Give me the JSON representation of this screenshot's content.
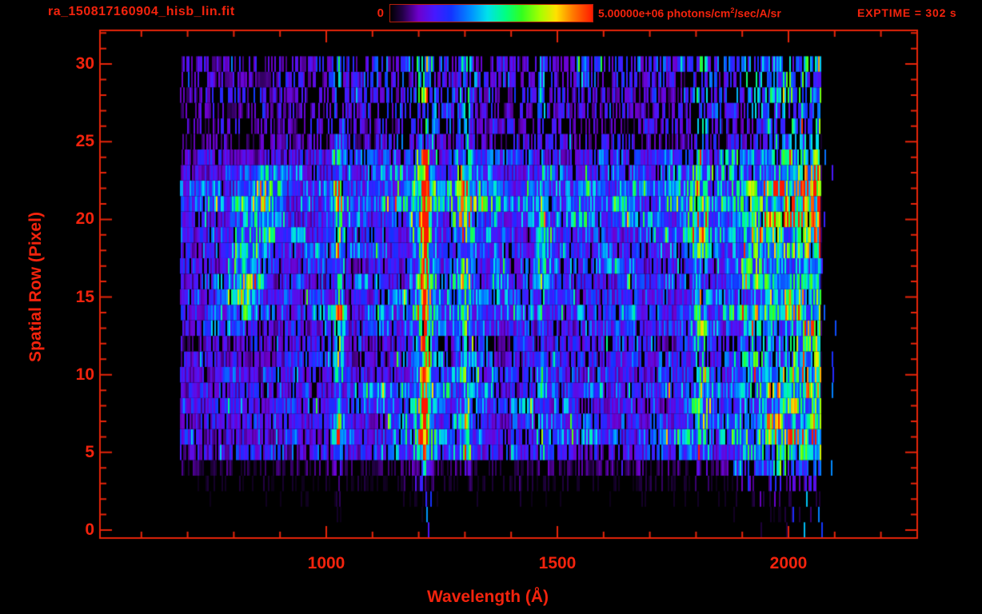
{
  "header": {
    "title": "ra_150817160904_hisb_lin.fit",
    "colorbar": {
      "min_label": "0",
      "max_value": "5.00000e+06",
      "units_prefix": "photons/cm",
      "units_sup": "2",
      "units_suffix": "/sec/A/sr"
    },
    "exptime": "EXPTIME = 302 s"
  },
  "axes": {
    "x": {
      "title": "Wavelength (Å)",
      "major_ticks": [
        1000,
        1500,
        2000
      ],
      "minor_step": 100,
      "range": [
        510,
        2278
      ]
    },
    "y": {
      "title": "Spatial Row (Pixel)",
      "major_ticks": [
        0,
        5,
        10,
        15,
        20,
        25,
        30
      ],
      "minor_step": 1,
      "range": [
        -0.5,
        32.2
      ]
    }
  },
  "chart_data": {
    "type": "heatmap",
    "title": "ra_150817160904_hisb_lin.fit",
    "xlabel": "Wavelength (Å)",
    "ylabel": "Spatial Row (Pixel)",
    "xlim": [
      510,
      2278
    ],
    "ylim": [
      -0.5,
      32.2
    ],
    "colorbar": {
      "min": 0,
      "max": 5000000,
      "units": "photons/cm2/sec/A/sr"
    },
    "exposure_s": 302,
    "data_extent": {
      "wavelength": [
        683,
        2071
      ],
      "rows": [
        0,
        30
      ]
    },
    "row_profile": [
      0.02,
      0.03,
      0.05,
      0.1,
      0.22,
      0.62,
      0.72,
      0.7,
      0.68,
      0.7,
      0.63,
      0.58,
      0.52,
      0.68,
      0.76,
      0.74,
      0.68,
      0.66,
      0.72,
      0.78,
      0.84,
      0.88,
      0.84,
      0.74,
      0.62,
      0.46,
      0.44,
      0.46,
      0.5,
      0.52,
      0.55
    ],
    "row_dropout": [
      0.85,
      0.82,
      0.8,
      0.7,
      0.5,
      0.22,
      0.2,
      0.2,
      0.2,
      0.2,
      0.22,
      0.24,
      0.28,
      0.2,
      0.18,
      0.18,
      0.2,
      0.2,
      0.18,
      0.16,
      0.14,
      0.13,
      0.14,
      0.16,
      0.22,
      0.5,
      0.52,
      0.5,
      0.48,
      0.46,
      0.44
    ],
    "continuum_breakpoints": [
      [
        683,
        0.3
      ],
      [
        780,
        0.34
      ],
      [
        1100,
        0.4
      ],
      [
        1160,
        0.5
      ],
      [
        1330,
        0.5
      ],
      [
        1380,
        0.4
      ],
      [
        1840,
        0.42
      ],
      [
        1900,
        0.62
      ],
      [
        1960,
        0.8
      ],
      [
        2040,
        0.85
      ],
      [
        2056,
        0.9
      ],
      [
        2064,
        1.15
      ],
      [
        2070,
        1.15
      ],
      [
        2071,
        0.0
      ]
    ],
    "lines": [
      {
        "wavelength": 1027,
        "sigma": 6,
        "amplitude": 0.55
      },
      {
        "wavelength": 1213,
        "sigma": 4.5,
        "amplitude": 1.1,
        "rows": [
          5,
          24
        ],
        "soft_factor": 0.3,
        "jitter": true
      },
      {
        "wavelength": 1213,
        "sigma": 13,
        "amplitude": 0.45,
        "rows": [
          4,
          30
        ],
        "soft_factor": 0.5
      },
      {
        "wavelength": 1302,
        "sigma": 10,
        "amplitude": 0.3
      },
      {
        "wavelength": 1368,
        "sigma": 6,
        "amplitude": 0.18,
        "rows": [
          16,
          23
        ],
        "soft_factor": 0
      },
      {
        "wavelength": 1467,
        "sigma": 6,
        "amplitude": 0.3
      },
      {
        "wavelength": 1558,
        "sigma": 6,
        "amplitude": 0.15,
        "rows": [
          18,
          23
        ],
        "soft_factor": 0
      },
      {
        "wavelength": 1810,
        "sigma": 13,
        "amplitude": 0.32
      }
    ],
    "blob": {
      "row_center": 17.5,
      "row_sigma": 4.2,
      "rows": [
        12.5,
        23.8
      ],
      "wavelength_base": 800,
      "wavelength_slope": 6.5,
      "wavelength_sigma": 27,
      "amplitude": 0.52
    },
    "bottom_right_boost": {
      "rows": [
        0,
        4
      ],
      "wavelength": [
        1880,
        2071
      ],
      "factor": 2.2
    },
    "stray_speckles": [
      {
        "rows": [
          0,
          3
        ],
        "wavelength": [
          1185,
          1235
        ],
        "probability": 0.1,
        "intensity": 0.3
      },
      {
        "rows": [
          0,
          24
        ],
        "wavelength": [
          2072,
          2106
        ],
        "probability": 0.05,
        "intensity": 0.3
      },
      {
        "rows": [
          0,
          2
        ],
        "wavelength": [
          2000,
          2070
        ],
        "probability": 0.06,
        "intensity": 0.35
      }
    ],
    "colormap_stops": [
      [
        0.0,
        [
          0,
          0,
          0
        ]
      ],
      [
        0.06,
        [
          35,
          0,
          70
        ]
      ],
      [
        0.14,
        [
          110,
          0,
          205
        ]
      ],
      [
        0.22,
        [
          70,
          25,
          255
        ]
      ],
      [
        0.3,
        [
          20,
          50,
          255
        ]
      ],
      [
        0.4,
        [
          0,
          145,
          255
        ]
      ],
      [
        0.48,
        [
          0,
          225,
          235
        ]
      ],
      [
        0.57,
        [
          0,
          255,
          130
        ]
      ],
      [
        0.65,
        [
          50,
          255,
          30
        ]
      ],
      [
        0.74,
        [
          165,
          255,
          0
        ]
      ],
      [
        0.82,
        [
          255,
          225,
          0
        ]
      ],
      [
        0.9,
        [
          255,
          125,
          0
        ]
      ],
      [
        1.0,
        [
          255,
          25,
          0
        ]
      ]
    ],
    "axis_color": "#e8250a",
    "text_color": "#f2230d",
    "noise_seed": 1337
  }
}
